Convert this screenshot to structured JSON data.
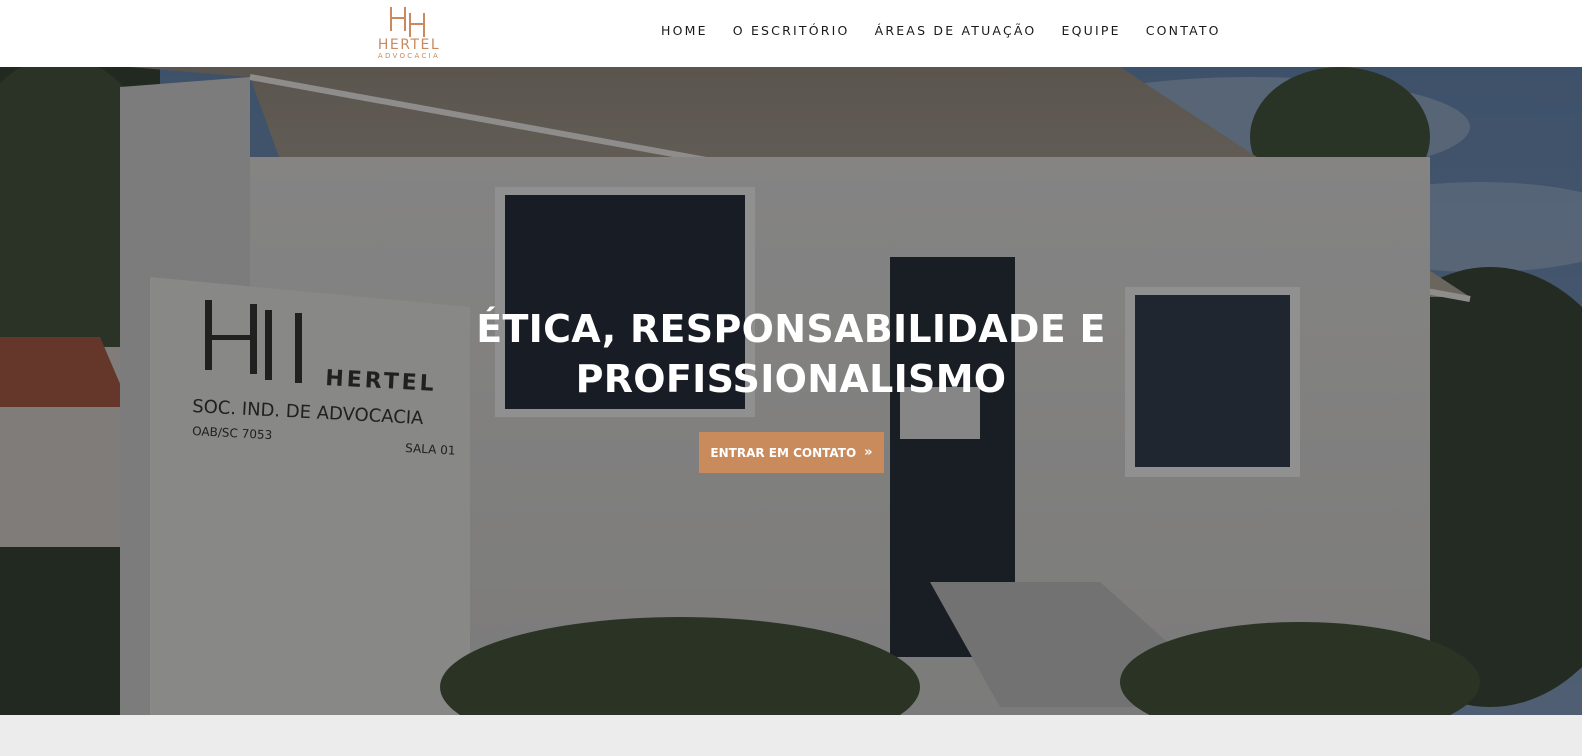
{
  "header": {
    "logo": {
      "name": "HERTEL",
      "subtitle": "ADVOCACIA",
      "mark": "HH"
    },
    "nav": [
      {
        "label": "HOME"
      },
      {
        "label": "O ESCRITÓRIO"
      },
      {
        "label": "ÁREAS DE ATUAÇÃO"
      },
      {
        "label": "EQUIPE"
      },
      {
        "label": "CONTATO"
      }
    ]
  },
  "hero": {
    "headline_line1": "ÉTICA, RESPONSABILIDADE E",
    "headline_line2": "PROFISSIONALISMO",
    "cta_label": "ENTRAR EM CONTATO",
    "cta_icon": "double-chevron-right-icon",
    "sign": {
      "mark": "HH",
      "name": "HERTEL",
      "line1": "SOC. IND. DE ADVOCACIA",
      "line2": "OAB/SC 7053",
      "line3": "SALA 01"
    }
  },
  "colors": {
    "accent": "#c98a5c",
    "logo": "#c88a5e",
    "header_bg": "#ffffff",
    "footer_band": "#ececec"
  }
}
